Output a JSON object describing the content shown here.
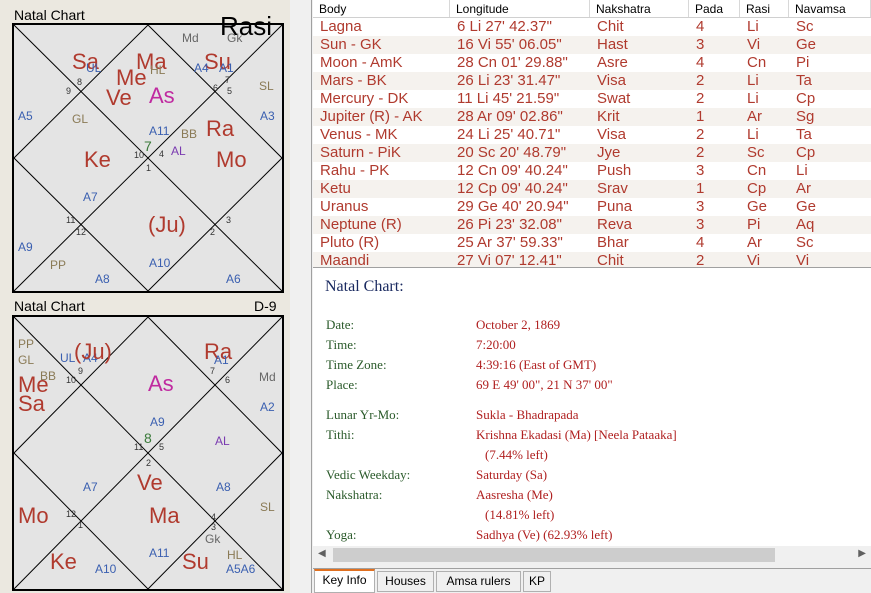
{
  "rasi_chart": {
    "title": "Natal Chart",
    "corner_label": "Rasi",
    "labels": {
      "sa": "Sa",
      "ma": "Ma",
      "su": "Su",
      "me": "Me",
      "ve": "Ve",
      "as": "As",
      "ra": "Ra",
      "mo": "Mo",
      "ke": "Ke",
      "ju": "(Ju)",
      "md": "Md",
      "gk": "Gk",
      "ul": "UL",
      "hl": "HL",
      "a4": "A4",
      "a1": "A1",
      "sl": "SL",
      "a5": "A5",
      "a3": "A3",
      "gl": "GL",
      "a11": "A11",
      "bb": "BB",
      "al": "AL",
      "a7": "A7",
      "a9": "A9",
      "pp": "PP",
      "a8": "A8",
      "a10": "A10",
      "a6": "A6"
    },
    "house_numbers": [
      "7",
      "6",
      "5",
      "8",
      "4",
      "9",
      "10",
      "11",
      "12",
      "1",
      "2",
      "3"
    ]
  },
  "navamsa_chart": {
    "title": "Natal Chart",
    "corner_label": "D-9",
    "labels": {
      "pp": "PP",
      "gl": "GL",
      "ul": "UL",
      "a4": "A4",
      "ju": "(Ju)",
      "ra": "Ra",
      "a1": "A1",
      "bb": "BB",
      "me": "Me",
      "sa": "Sa",
      "as": "As",
      "md": "Md",
      "a2": "A2",
      "a9": "A9",
      "al": "AL",
      "a7": "A7",
      "ve": "Ve",
      "ma": "Ma",
      "a8": "A8",
      "mo": "Mo",
      "sl": "SL",
      "gk": "Gk",
      "a11": "A11",
      "hl": "HL",
      "ke": "Ke",
      "a10": "A10",
      "su": "Su",
      "a5a6": "A5A6"
    },
    "house_numbers": [
      "9",
      "7",
      "10",
      "6",
      "11",
      "8",
      "5",
      "4",
      "12",
      "1",
      "3",
      "2"
    ]
  },
  "table": {
    "headers": [
      "Body",
      "Longitude",
      "Nakshatra",
      "Pada",
      "Rasi",
      "Navamsa"
    ],
    "rows": [
      [
        "Lagna",
        "6 Li 27' 42.37\"",
        "Chit",
        "4",
        "Li",
        "Sc"
      ],
      [
        "Sun - GK",
        "16 Vi 55' 06.05\"",
        "Hast",
        "3",
        "Vi",
        "Ge"
      ],
      [
        "Moon - AmK",
        "28 Cn 01' 29.88\"",
        "Asre",
        "4",
        "Cn",
        "Pi"
      ],
      [
        "Mars - BK",
        "26 Li 23' 31.47\"",
        "Visa",
        "2",
        "Li",
        "Ta"
      ],
      [
        "Mercury - DK",
        "11 Li 45' 21.59\"",
        "Swat",
        "2",
        "Li",
        "Cp"
      ],
      [
        "Jupiter (R) - AK",
        "28 Ar 09' 02.86\"",
        "Krit",
        "1",
        "Ar",
        "Sg"
      ],
      [
        "Venus - MK",
        "24 Li 25' 40.71\"",
        "Visa",
        "2",
        "Li",
        "Ta"
      ],
      [
        "Saturn - PiK",
        "20 Sc 20' 48.79\"",
        "Jye",
        "2",
        "Sc",
        "Cp"
      ],
      [
        "Rahu - PK",
        "12 Cn 09' 40.24\"",
        "Push",
        "3",
        "Cn",
        "Li"
      ],
      [
        "Ketu",
        "12 Cp 09' 40.24\"",
        "Srav",
        "1",
        "Cp",
        "Ar"
      ],
      [
        "Uranus",
        "29 Ge 40' 20.94\"",
        "Puna",
        "3",
        "Ge",
        "Ge"
      ],
      [
        "Neptune (R)",
        "26 Pi 23' 32.08\"",
        "Reva",
        "3",
        "Pi",
        "Aq"
      ],
      [
        "Pluto (R)",
        "25 Ar 37' 59.33\"",
        "Bhar",
        "4",
        "Ar",
        "Sc"
      ],
      [
        "Maandi",
        "27 Vi 07' 12.41\"",
        "Chit",
        "2",
        "Vi",
        "Vi"
      ]
    ]
  },
  "info": {
    "title": "Natal Chart:",
    "date_label": "Date:",
    "date": "October 2, 1869",
    "time_label": "Time:",
    "time": "7:20:00",
    "tz_label": "Time Zone:",
    "tz": "4:39:16 (East of GMT)",
    "place_label": "Place:",
    "place": "69 E 49' 00\", 21 N 37' 00\"",
    "lunar_label": "Lunar Yr-Mo:",
    "lunar": "Sukla - Bhadrapada",
    "tithi_label": "Tithi:",
    "tithi": "Krishna Ekadasi (Ma) [Neela Pataaka]",
    "tithi_left": "(7.44% left)",
    "weekday_label": "Vedic Weekday:",
    "weekday": "Saturday (Sa)",
    "nakshatra_label": "Nakshatra:",
    "nakshatra": "Aasresha (Me)",
    "nakshatra_left": "(14.81% left)",
    "yoga_label": "Yoga:",
    "yoga": "Sadhya (Ve) (62.93% left)"
  },
  "tabs": [
    "Key Info",
    "Houses",
    "Amsa rulers",
    "KP"
  ]
}
